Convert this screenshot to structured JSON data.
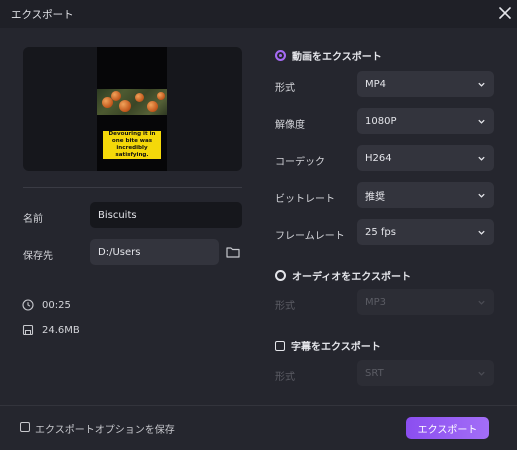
{
  "window": {
    "title": "エクスポート"
  },
  "preview": {
    "caption": "Devouring it in one bite was incredibly satisfying."
  },
  "fields": {
    "name": {
      "label": "名前",
      "value": "Biscuits"
    },
    "save_to": {
      "label": "保存先",
      "value": "D:/Users"
    }
  },
  "info": {
    "duration": "00:25",
    "size": "24.6MB"
  },
  "video_export": {
    "label": "動画をエクスポート",
    "checked": true,
    "rows": [
      {
        "label": "形式",
        "value": "MP4"
      },
      {
        "label": "解像度",
        "value": "1080P"
      },
      {
        "label": "コーデック",
        "value": "H264"
      },
      {
        "label": "ビットレート",
        "value": "推奨"
      },
      {
        "label": "フレームレート",
        "value": "25  fps"
      }
    ]
  },
  "audio_export": {
    "label": "オーディオをエクスポート",
    "checked": false,
    "rows": [
      {
        "label": "形式",
        "value": "MP3"
      }
    ]
  },
  "subtitle_export": {
    "label": "字幕をエクスポート",
    "checked": false,
    "rows": [
      {
        "label": "形式",
        "value": "SRT"
      }
    ]
  },
  "footer": {
    "save_options_label": "エクスポートオプションを保存",
    "export_button": "エクスポート"
  },
  "colors": {
    "accent": "#a56bf5",
    "background": "#25262e",
    "input": "#16171c",
    "select": "#33343d"
  },
  "icons": [
    "close-icon",
    "folder-icon",
    "clock-icon",
    "file-size-icon",
    "chevron-down-icon"
  ]
}
